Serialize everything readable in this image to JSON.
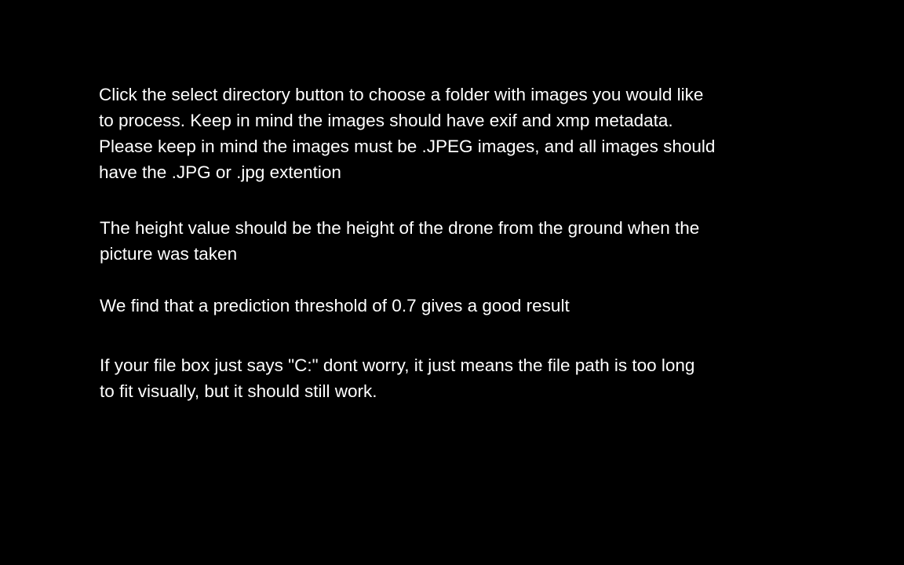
{
  "instructions": {
    "paragraph1": [
      "Click the select directory button to choose a folder with images you would like",
      "to process. Keep in mind the images should have exif and xmp metadata.",
      "Please keep in mind the images must be .JPEG images, and all images should",
      "have the .JPG or .jpg extention"
    ],
    "paragraph2": [
      "The height value should be the height of the drone from the ground when the",
      "picture was taken"
    ],
    "paragraph3": [
      "We find that a prediction threshold of 0.7 gives a good result"
    ],
    "paragraph4": [
      "If your file box just says \"C:\" dont worry, it just means the file path is too long",
      "to fit visually, but it should still work."
    ]
  },
  "colors": {
    "background": "#000000",
    "text": "#ffffff"
  }
}
